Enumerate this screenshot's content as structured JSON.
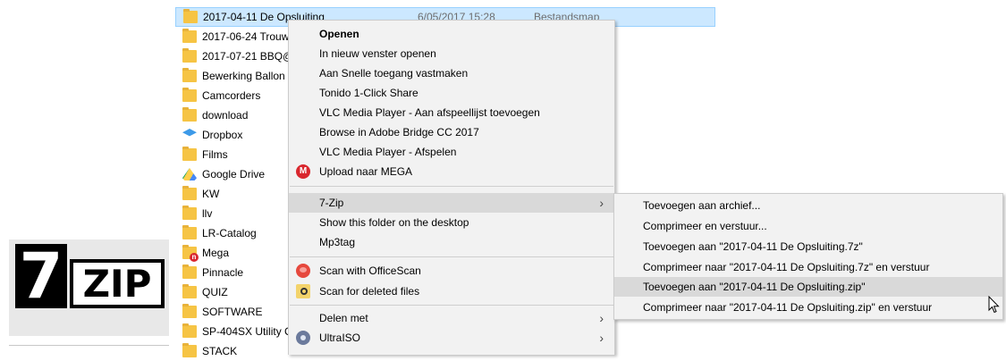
{
  "files": [
    {
      "name": "2017-04-11 De Opsluiting",
      "date": "6/05/2017 15:28",
      "type": "Bestandsmap",
      "icon": "folder-icon",
      "selected": true
    },
    {
      "name": "2017-06-24 Trouw",
      "icon": "folder-icon"
    },
    {
      "name": "2017-07-21 BBQ@",
      "icon": "folder-icon"
    },
    {
      "name": "Bewerking Ballon",
      "icon": "folder-icon"
    },
    {
      "name": "Camcorders",
      "icon": "folder-icon"
    },
    {
      "name": "download",
      "icon": "folder-icon"
    },
    {
      "name": "Dropbox",
      "icon": "dropbox-icon"
    },
    {
      "name": "Films",
      "icon": "folder-icon"
    },
    {
      "name": "Google Drive",
      "icon": "google-drive-icon"
    },
    {
      "name": "KW",
      "icon": "folder-icon"
    },
    {
      "name": "llv",
      "icon": "folder-icon"
    },
    {
      "name": "LR-Catalog",
      "icon": "folder-icon"
    },
    {
      "name": "Mega",
      "icon": "mega-folder-icon"
    },
    {
      "name": "Pinnacle",
      "icon": "folder-icon"
    },
    {
      "name": "QUIZ",
      "icon": "folder-icon"
    },
    {
      "name": "SOFTWARE",
      "icon": "folder-icon"
    },
    {
      "name": "SP-404SX Utility C",
      "icon": "folder-icon"
    },
    {
      "name": "STACK",
      "icon": "folder-icon"
    }
  ],
  "logo": {
    "seven": "7",
    "zip": "ZIP"
  },
  "context_menu": {
    "items": [
      {
        "label": "Openen",
        "bold": true
      },
      {
        "label": "In nieuw venster openen"
      },
      {
        "label": "Aan Snelle toegang vastmaken"
      },
      {
        "label": "Tonido 1-Click Share"
      },
      {
        "label": "VLC Media Player - Aan afspeellijst toevoegen"
      },
      {
        "label": "Browse in Adobe Bridge CC 2017"
      },
      {
        "label": "VLC Media Player - Afspelen"
      },
      {
        "label": "Upload naar MEGA",
        "icon": "mega-icon"
      },
      {
        "label": "7-Zip",
        "submenu": true,
        "hover": true
      },
      {
        "label": "Show this folder on the desktop"
      },
      {
        "label": "Mp3tag"
      },
      {
        "label": "Scan with OfficeScan",
        "icon": "officescan-icon"
      },
      {
        "label": "Scan for deleted files",
        "icon": "scan-deleted-icon"
      },
      {
        "label": "Delen met",
        "submenu": true
      },
      {
        "label": "UltraISO",
        "icon": "ultraiso-icon",
        "submenu": true
      }
    ]
  },
  "submenu_7zip": {
    "items": [
      {
        "label": "Toevoegen aan archief..."
      },
      {
        "label": "Comprimeer en verstuur..."
      },
      {
        "label": "Toevoegen aan \"2017-04-11 De Opsluiting.7z\""
      },
      {
        "label": "Comprimeer naar \"2017-04-11 De Opsluiting.7z\" en verstuur"
      },
      {
        "label": "Toevoegen aan \"2017-04-11 De Opsluiting.zip\"",
        "hover": true
      },
      {
        "label": "Comprimeer naar \"2017-04-11 De Opsluiting.zip\" en verstuur"
      }
    ]
  },
  "colors": {
    "selection": "#cce8ff",
    "menu_bg": "#f2f2f2",
    "menu_hover": "#d9d9d9",
    "folder": "#f6c444"
  }
}
